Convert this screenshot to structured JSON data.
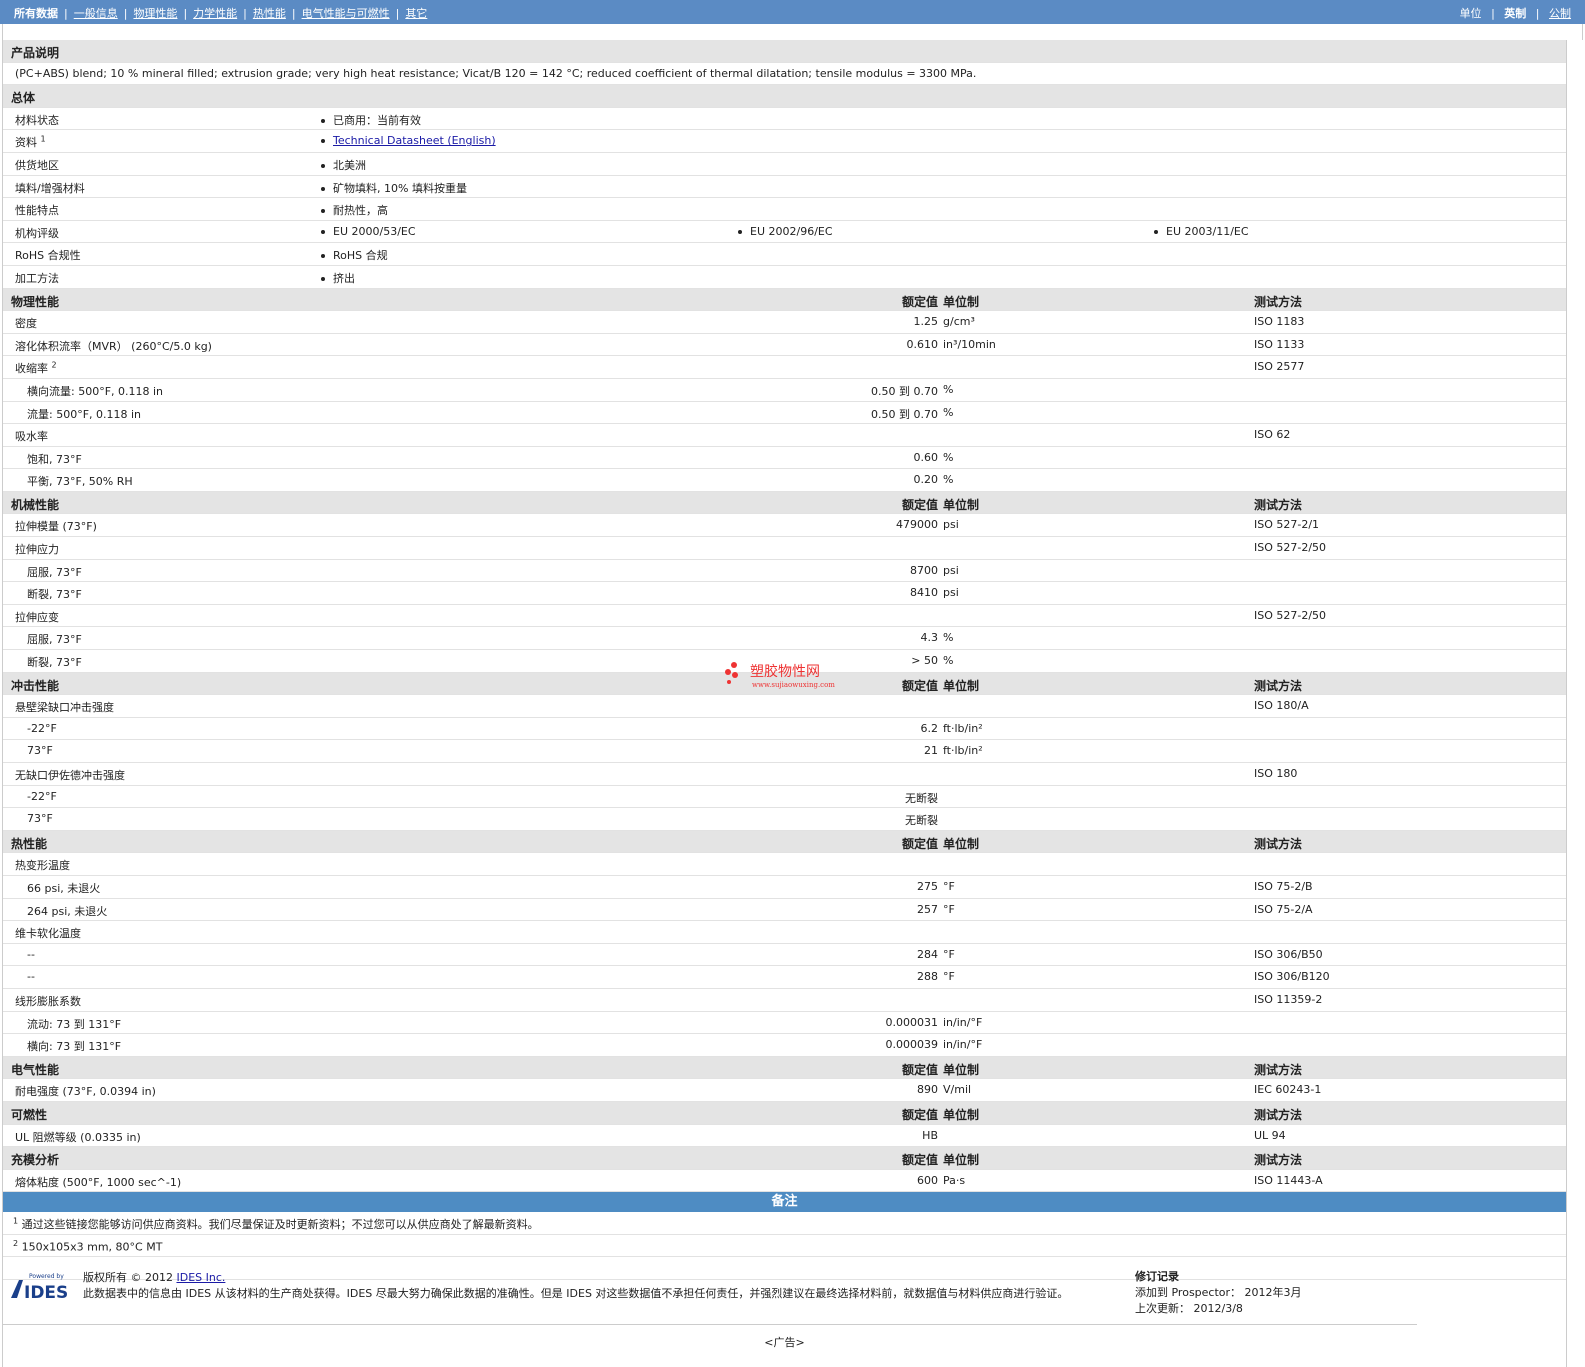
{
  "nav": {
    "items": [
      "所有数据",
      "一般信息",
      "物理性能",
      "力学性能",
      "热性能",
      "电气性能与可燃性",
      "其它"
    ],
    "units_label": "单位",
    "unit_options": [
      "英制",
      "公制"
    ]
  },
  "description": {
    "title": "产品说明",
    "text": "(PC+ABS) blend; 10 % mineral filled; extrusion grade; very high heat resistance; Vicat/B 120 = 142 °C; reduced coefficient of thermal dilatation; tensile modulus = 3300 MPa."
  },
  "general": {
    "title": "总体",
    "rows": [
      {
        "label": "材料状态",
        "values": [
          "已商用：当前有效"
        ]
      },
      {
        "label": "资料",
        "sup": "1",
        "values": [
          "Technical Datasheet (English)"
        ],
        "link": true
      },
      {
        "label": "供货地区",
        "values": [
          "北美洲"
        ]
      },
      {
        "label": "填料/增强材料",
        "values": [
          "矿物填料, 10% 填料按重量"
        ]
      },
      {
        "label": "性能特点",
        "values": [
          "耐热性，高"
        ]
      },
      {
        "label": "机构评级",
        "values": [
          "EU 2000/53/EC",
          "EU 2002/96/EC",
          "EU 2003/11/EC"
        ]
      },
      {
        "label": "RoHS 合规性",
        "values": [
          "RoHS 合规"
        ]
      },
      {
        "label": "加工方法",
        "values": [
          "挤出"
        ]
      }
    ]
  },
  "headers": {
    "value": "额定值",
    "unit": "单位制",
    "method": "测试方法"
  },
  "sections": [
    {
      "title": "物理性能",
      "rows": [
        {
          "label": "密度",
          "value": "1.25",
          "unit": "g/cm³",
          "method": "ISO 1183"
        },
        {
          "label": "溶化体积流率（MVR） (260°C/5.0 kg)",
          "value": "0.610",
          "unit": "in³/10min",
          "method": "ISO 1133"
        },
        {
          "label": "收缩率",
          "sup": "2",
          "method": "ISO 2577"
        },
        {
          "label": "横向流量: 500°F, 0.118 in",
          "sub": true,
          "value": "0.50 到  0.70",
          "unit": "%"
        },
        {
          "label": "流量: 500°F, 0.118 in",
          "sub": true,
          "value": "0.50 到  0.70",
          "unit": "%"
        },
        {
          "label": "吸水率",
          "method": "ISO 62"
        },
        {
          "label": "饱和, 73°F",
          "sub": true,
          "value": "0.60",
          "unit": "%"
        },
        {
          "label": "平衡, 73°F, 50% RH",
          "sub": true,
          "value": "0.20",
          "unit": "%"
        }
      ]
    },
    {
      "title": "机械性能",
      "rows": [
        {
          "label": "拉伸模量 (73°F)",
          "value": "479000",
          "unit": "psi",
          "method": "ISO 527-2/1"
        },
        {
          "label": "拉伸应力",
          "method": "ISO 527-2/50"
        },
        {
          "label": "屈服, 73°F",
          "sub": true,
          "value": "8700",
          "unit": "psi"
        },
        {
          "label": "断裂, 73°F",
          "sub": true,
          "value": "8410",
          "unit": "psi"
        },
        {
          "label": "拉伸应变",
          "method": "ISO 527-2/50"
        },
        {
          "label": "屈服, 73°F",
          "sub": true,
          "value": "4.3",
          "unit": "%"
        },
        {
          "label": "断裂, 73°F",
          "sub": true,
          "value": "> 50",
          "unit": "%"
        }
      ]
    },
    {
      "title": "冲击性能",
      "rows": [
        {
          "label": "悬壁梁缺口冲击强度",
          "method": "ISO 180/A"
        },
        {
          "label": "-22°F",
          "sub": true,
          "value": "6.2",
          "unit": "ft·lb/in²"
        },
        {
          "label": "73°F",
          "sub": true,
          "value": "21",
          "unit": "ft·lb/in²"
        },
        {
          "label": "无缺口伊佐德冲击强度",
          "method": "ISO 180"
        },
        {
          "label": "-22°F",
          "sub": true,
          "value": "无断裂"
        },
        {
          "label": "73°F",
          "sub": true,
          "value": "无断裂"
        }
      ]
    },
    {
      "title": "热性能",
      "rows": [
        {
          "label": "热变形温度"
        },
        {
          "label": "66 psi, 未退火",
          "sub": true,
          "value": "275",
          "unit": "°F",
          "method": "ISO 75-2/B"
        },
        {
          "label": "264 psi, 未退火",
          "sub": true,
          "value": "257",
          "unit": "°F",
          "method": "ISO 75-2/A"
        },
        {
          "label": "维卡软化温度"
        },
        {
          "label": "--",
          "sub": true,
          "value": "284",
          "unit": "°F",
          "method": "ISO 306/B50"
        },
        {
          "label": "--",
          "sub": true,
          "value": "288",
          "unit": "°F",
          "method": "ISO 306/B120"
        },
        {
          "label": "线形膨胀系数",
          "method": "ISO 11359-2"
        },
        {
          "label": "流动: 73 到  131°F",
          "sub": true,
          "value": "0.000031",
          "unit": "in/in/°F"
        },
        {
          "label": "横向: 73 到  131°F",
          "sub": true,
          "value": "0.000039",
          "unit": "in/in/°F"
        }
      ]
    },
    {
      "title": "电气性能",
      "rows": [
        {
          "label": "耐电强度 (73°F, 0.0394 in)",
          "value": "890",
          "unit": "V/mil",
          "method": "IEC 60243-1"
        }
      ]
    },
    {
      "title": "可燃性",
      "rows": [
        {
          "label": "UL 阻燃等级 (0.0335 in)",
          "value": "HB",
          "method": "UL 94"
        }
      ]
    },
    {
      "title": "充模分析",
      "rows": [
        {
          "label": "熔体粘度 (500°F, 1000 sec^-1)",
          "value": "600",
          "unit": "Pa·s",
          "method": "ISO 11443-A"
        }
      ]
    }
  ],
  "notes": {
    "title": "备注",
    "items": [
      {
        "num": "1",
        "text": "通过这些链接您能够访问供应商资料。我们尽量保证及时更新资料；不过您可以从供应商处了解最新资料。"
      },
      {
        "num": "2",
        "text": "150x105x3 mm, 80°C MT"
      }
    ]
  },
  "footer": {
    "logo_small": "Powered by",
    "logo_text": "IDES",
    "copyright_prefix": "版权所有 © 2012 ",
    "copyright_link": "IDES Inc.",
    "disclaimer": "此数据表中的信息由 IDES 从该材料的生产商处获得。IDES 尽最大努力确保此数据的准确性。但是 IDES 对这些数据值不承担任何责任，并强烈建议在最终选择材料前，就数据值与材料供应商进行验证。",
    "rev_title": "修订记录",
    "added_label": "添加到 Prospector：",
    "added_value": "2012年3月",
    "updated_label": "上次更新：",
    "updated_value": "2012/3/8",
    "ad": "<广告>"
  },
  "watermark": {
    "text": "塑胶物性网",
    "url": "www.sujiaowuxing.com"
  }
}
